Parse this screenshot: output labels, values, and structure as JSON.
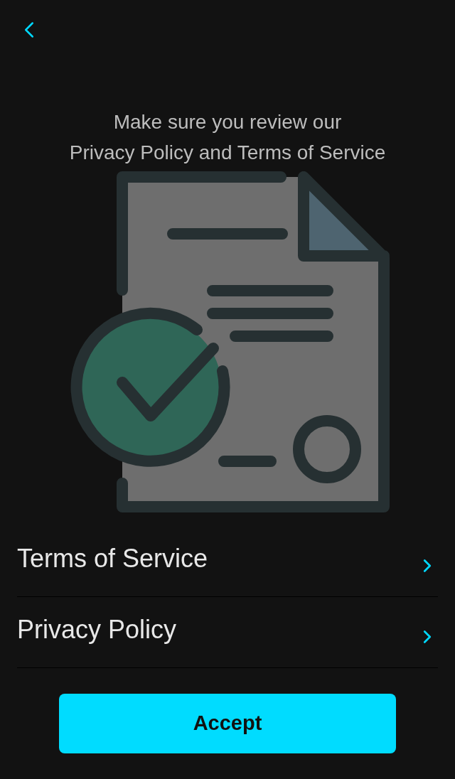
{
  "intro": {
    "lines": [
      "Make sure you review our",
      "Privacy Policy and Terms of Service"
    ]
  },
  "links": [
    {
      "label": "Terms of Service"
    },
    {
      "label": "Privacy Policy"
    }
  ],
  "accept_button": {
    "label": "Accept"
  }
}
